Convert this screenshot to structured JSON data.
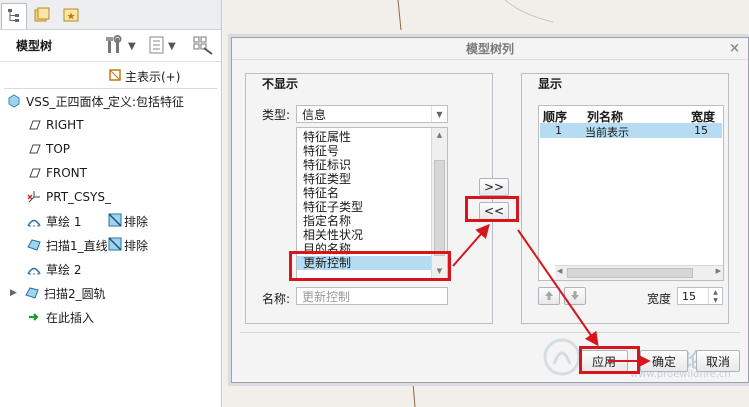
{
  "tree": {
    "title": "模型树",
    "column_header": "主表示(+)",
    "root_label": "VSS_正四面体_",
    "root_extra": "定义:包括特征",
    "items": [
      {
        "label": "RIGHT",
        "icon": "datum-plane-icon"
      },
      {
        "label": "TOP",
        "icon": "datum-plane-icon"
      },
      {
        "label": "FRONT",
        "icon": "datum-plane-icon"
      },
      {
        "label": "PRT_CSYS_",
        "icon": "csys-icon"
      },
      {
        "label": "草绘 1",
        "icon": "sketch-icon",
        "extra": "排除"
      },
      {
        "label": "扫描1_直线",
        "icon": "sweep-icon",
        "extra": "排除"
      },
      {
        "label": "草绘 2",
        "icon": "sketch-icon"
      },
      {
        "label": "扫描2_圆轨",
        "icon": "sweep-icon"
      },
      {
        "label": "在此插入",
        "icon": "insert-arrow-icon"
      }
    ]
  },
  "dialog": {
    "title": "模型树列",
    "close": "×",
    "left_group": "不显示",
    "type_label": "类型:",
    "type_value": "信息",
    "list_items": [
      "特征属性",
      "特征号",
      "特征标识",
      "特征类型",
      "特征名",
      "特征子类型",
      "指定名称",
      "相关性状况",
      "目的名称",
      "更新控制"
    ],
    "selected_item": "更新控制",
    "name_label": "名称:",
    "name_placeholder": "更新控制",
    "add_button": ">>",
    "remove_button": "<<",
    "right_group": "显示",
    "columns": [
      "顺序",
      "列名称",
      "宽度"
    ],
    "rows": [
      {
        "order": "1",
        "name": "当前表示",
        "width": "15"
      }
    ],
    "width_label": "宽度",
    "width_value": "15",
    "apply": "应用",
    "ok": "确定",
    "cancel": "取消"
  },
  "watermark": {
    "logo_text": "野火论坛",
    "url": "www.proewildfire.cn"
  },
  "colors": {
    "highlight": "#d6161c",
    "selection": "#b5dcf2"
  }
}
